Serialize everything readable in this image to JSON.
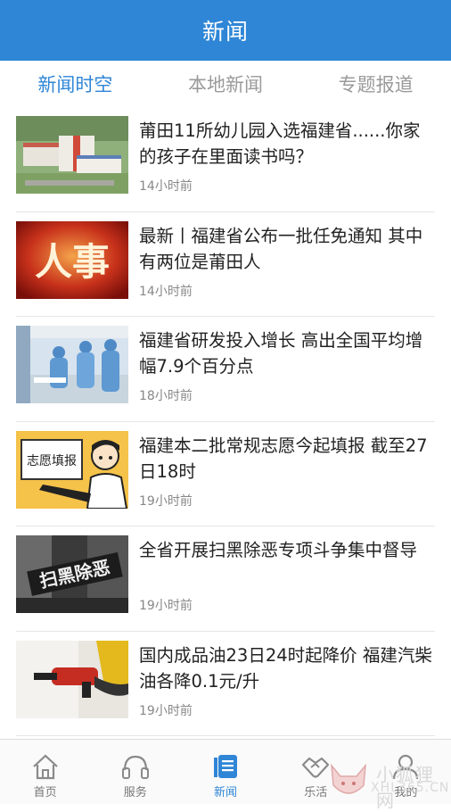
{
  "header": {
    "title": "新闻"
  },
  "tabs": [
    {
      "label": "新闻时空",
      "active": true
    },
    {
      "label": "本地新闻",
      "active": false
    },
    {
      "label": "专题报道",
      "active": false
    }
  ],
  "news": [
    {
      "title": "莆田11所幼儿园入选福建省......你家的孩子在里面读书吗？",
      "time": "14小时前",
      "thumb": "kindergarten-building-photo"
    },
    {
      "title": "最新丨福建省公布一批任免通知 其中有两位是莆田人",
      "time": "14小时前",
      "thumb": "personnel-red-graphic"
    },
    {
      "title": "福建省研发投入增长 高出全国平均增幅7.9个百分点",
      "time": "18小时前",
      "thumb": "lab-researchers-photo"
    },
    {
      "title": "福建本二批常规志愿今起填报 截至27日18时",
      "time": "19小时前",
      "thumb": "student-holding-sign-illustration"
    },
    {
      "title": "全省开展扫黑除恶专项斗争集中督导",
      "time": "19小时前",
      "thumb": "crackdown-banner-photo"
    },
    {
      "title": "国内成品油23日24时起降价 福建汽柴油各降0.1元/升",
      "time": "19小时前",
      "thumb": "fuel-nozzle-photo"
    }
  ],
  "thumb_text": {
    "personnel": "人事",
    "sign": "志愿填报",
    "crackdown": "扫黑除恶"
  },
  "bottom_nav": [
    {
      "label": "首页",
      "icon": "home-icon",
      "active": false
    },
    {
      "label": "服务",
      "icon": "headset-icon",
      "active": false
    },
    {
      "label": "新闻",
      "icon": "newspaper-icon",
      "active": true
    },
    {
      "label": "乐活",
      "icon": "handshake-icon",
      "active": false
    },
    {
      "label": "我的",
      "icon": "user-icon",
      "active": false
    }
  ],
  "watermark": {
    "line1": "小狐狸网",
    "line2": "XHL365.CN"
  },
  "colors": {
    "accent": "#2f86d6",
    "text": "#222222",
    "muted": "#888888"
  }
}
